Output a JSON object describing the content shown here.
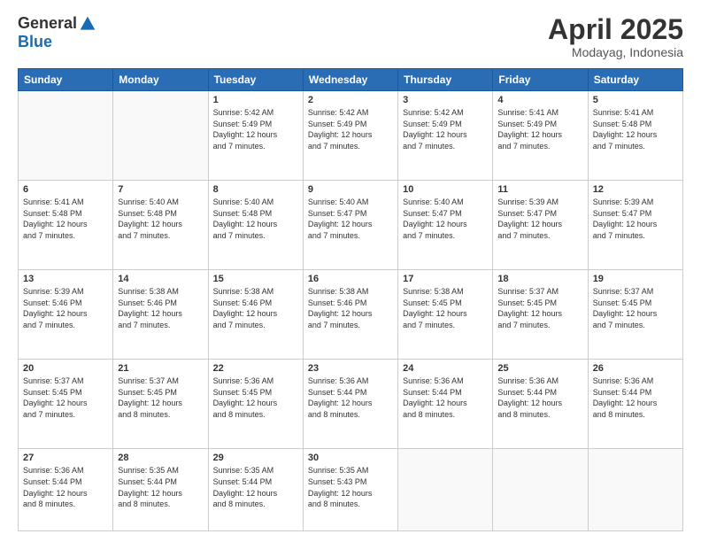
{
  "logo": {
    "general": "General",
    "blue": "Blue"
  },
  "title": "April 2025",
  "location": "Modayag, Indonesia",
  "days": [
    "Sunday",
    "Monday",
    "Tuesday",
    "Wednesday",
    "Thursday",
    "Friday",
    "Saturday"
  ],
  "weeks": [
    [
      {
        "day": "",
        "text": ""
      },
      {
        "day": "",
        "text": ""
      },
      {
        "day": "1",
        "text": "Sunrise: 5:42 AM\nSunset: 5:49 PM\nDaylight: 12 hours\nand 7 minutes."
      },
      {
        "day": "2",
        "text": "Sunrise: 5:42 AM\nSunset: 5:49 PM\nDaylight: 12 hours\nand 7 minutes."
      },
      {
        "day": "3",
        "text": "Sunrise: 5:42 AM\nSunset: 5:49 PM\nDaylight: 12 hours\nand 7 minutes."
      },
      {
        "day": "4",
        "text": "Sunrise: 5:41 AM\nSunset: 5:49 PM\nDaylight: 12 hours\nand 7 minutes."
      },
      {
        "day": "5",
        "text": "Sunrise: 5:41 AM\nSunset: 5:48 PM\nDaylight: 12 hours\nand 7 minutes."
      }
    ],
    [
      {
        "day": "6",
        "text": "Sunrise: 5:41 AM\nSunset: 5:48 PM\nDaylight: 12 hours\nand 7 minutes."
      },
      {
        "day": "7",
        "text": "Sunrise: 5:40 AM\nSunset: 5:48 PM\nDaylight: 12 hours\nand 7 minutes."
      },
      {
        "day": "8",
        "text": "Sunrise: 5:40 AM\nSunset: 5:48 PM\nDaylight: 12 hours\nand 7 minutes."
      },
      {
        "day": "9",
        "text": "Sunrise: 5:40 AM\nSunset: 5:47 PM\nDaylight: 12 hours\nand 7 minutes."
      },
      {
        "day": "10",
        "text": "Sunrise: 5:40 AM\nSunset: 5:47 PM\nDaylight: 12 hours\nand 7 minutes."
      },
      {
        "day": "11",
        "text": "Sunrise: 5:39 AM\nSunset: 5:47 PM\nDaylight: 12 hours\nand 7 minutes."
      },
      {
        "day": "12",
        "text": "Sunrise: 5:39 AM\nSunset: 5:47 PM\nDaylight: 12 hours\nand 7 minutes."
      }
    ],
    [
      {
        "day": "13",
        "text": "Sunrise: 5:39 AM\nSunset: 5:46 PM\nDaylight: 12 hours\nand 7 minutes."
      },
      {
        "day": "14",
        "text": "Sunrise: 5:38 AM\nSunset: 5:46 PM\nDaylight: 12 hours\nand 7 minutes."
      },
      {
        "day": "15",
        "text": "Sunrise: 5:38 AM\nSunset: 5:46 PM\nDaylight: 12 hours\nand 7 minutes."
      },
      {
        "day": "16",
        "text": "Sunrise: 5:38 AM\nSunset: 5:46 PM\nDaylight: 12 hours\nand 7 minutes."
      },
      {
        "day": "17",
        "text": "Sunrise: 5:38 AM\nSunset: 5:45 PM\nDaylight: 12 hours\nand 7 minutes."
      },
      {
        "day": "18",
        "text": "Sunrise: 5:37 AM\nSunset: 5:45 PM\nDaylight: 12 hours\nand 7 minutes."
      },
      {
        "day": "19",
        "text": "Sunrise: 5:37 AM\nSunset: 5:45 PM\nDaylight: 12 hours\nand 7 minutes."
      }
    ],
    [
      {
        "day": "20",
        "text": "Sunrise: 5:37 AM\nSunset: 5:45 PM\nDaylight: 12 hours\nand 7 minutes."
      },
      {
        "day": "21",
        "text": "Sunrise: 5:37 AM\nSunset: 5:45 PM\nDaylight: 12 hours\nand 8 minutes."
      },
      {
        "day": "22",
        "text": "Sunrise: 5:36 AM\nSunset: 5:45 PM\nDaylight: 12 hours\nand 8 minutes."
      },
      {
        "day": "23",
        "text": "Sunrise: 5:36 AM\nSunset: 5:44 PM\nDaylight: 12 hours\nand 8 minutes."
      },
      {
        "day": "24",
        "text": "Sunrise: 5:36 AM\nSunset: 5:44 PM\nDaylight: 12 hours\nand 8 minutes."
      },
      {
        "day": "25",
        "text": "Sunrise: 5:36 AM\nSunset: 5:44 PM\nDaylight: 12 hours\nand 8 minutes."
      },
      {
        "day": "26",
        "text": "Sunrise: 5:36 AM\nSunset: 5:44 PM\nDaylight: 12 hours\nand 8 minutes."
      }
    ],
    [
      {
        "day": "27",
        "text": "Sunrise: 5:36 AM\nSunset: 5:44 PM\nDaylight: 12 hours\nand 8 minutes."
      },
      {
        "day": "28",
        "text": "Sunrise: 5:35 AM\nSunset: 5:44 PM\nDaylight: 12 hours\nand 8 minutes."
      },
      {
        "day": "29",
        "text": "Sunrise: 5:35 AM\nSunset: 5:44 PM\nDaylight: 12 hours\nand 8 minutes."
      },
      {
        "day": "30",
        "text": "Sunrise: 5:35 AM\nSunset: 5:43 PM\nDaylight: 12 hours\nand 8 minutes."
      },
      {
        "day": "",
        "text": ""
      },
      {
        "day": "",
        "text": ""
      },
      {
        "day": "",
        "text": ""
      }
    ]
  ]
}
